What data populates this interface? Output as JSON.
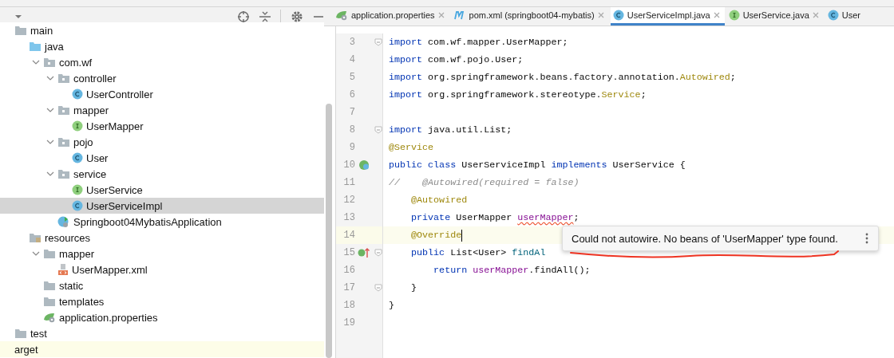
{
  "project_toolbar": {
    "buttons": [
      {
        "kind": "dropdown"
      },
      {
        "kind": "locate"
      },
      {
        "kind": "collapse"
      },
      {
        "kind": "settings"
      },
      {
        "kind": "minimize"
      }
    ]
  },
  "tabs": [
    {
      "label": "application.properties",
      "kind": "properties",
      "selected": false
    },
    {
      "label": "pom.xml (springboot04-mybatis)",
      "kind": "maven",
      "selected": false
    },
    {
      "label": "UserServiceImpl.java",
      "kind": "class",
      "selected": true
    },
    {
      "label": "UserService.java",
      "kind": "interface",
      "selected": false
    },
    {
      "label": "User",
      "kind": "class",
      "selected": false
    }
  ],
  "tree": [
    {
      "label": "main",
      "kind": "folder",
      "selected": false,
      "children": [
        {
          "label": "java",
          "kind": "source",
          "selected": false,
          "children": [
            {
              "label": "com.wf",
              "kind": "package",
              "expanded": true,
              "selected": false,
              "children": [
                {
                  "label": "controller",
                  "kind": "package",
                  "expanded": true,
                  "selected": false,
                  "children": [
                    {
                      "label": "UserController",
                      "kind": "class",
                      "selected": false
                    }
                  ]
                },
                {
                  "label": "mapper",
                  "kind": "package",
                  "expanded": true,
                  "selected": false,
                  "children": [
                    {
                      "label": "UserMapper",
                      "kind": "interface",
                      "selected": false
                    }
                  ]
                },
                {
                  "label": "pojo",
                  "kind": "package",
                  "expanded": true,
                  "selected": false,
                  "children": [
                    {
                      "label": "User",
                      "kind": "class",
                      "selected": false
                    }
                  ]
                },
                {
                  "label": "service",
                  "kind": "package",
                  "expanded": true,
                  "selected": false,
                  "children": [
                    {
                      "label": "UserService",
                      "kind": "interface",
                      "selected": false
                    },
                    {
                      "label": "UserServiceImpl",
                      "kind": "class",
                      "selected": true
                    }
                  ]
                },
                {
                  "label": "Springboot04MybatisApplication",
                  "kind": "app",
                  "selected": false
                }
              ]
            }
          ]
        },
        {
          "label": "resources",
          "kind": "resources",
          "selected": false,
          "children": [
            {
              "label": "mapper",
              "kind": "folder",
              "expanded": true,
              "selected": false,
              "children": [
                {
                  "label": "UserMapper.xml",
                  "kind": "xml",
                  "selected": false
                }
              ]
            },
            {
              "label": "static",
              "kind": "folder",
              "selected": false
            },
            {
              "label": "templates",
              "kind": "folder",
              "selected": false
            },
            {
              "label": "application.properties",
              "kind": "properties",
              "selected": false
            }
          ]
        }
      ]
    },
    {
      "label": "test",
      "kind": "folder",
      "selected": false
    },
    {
      "label": "arget",
      "kind": "excluded",
      "selected": false
    }
  ],
  "editor": {
    "lines": [
      {
        "number": "3",
        "kind": "plain",
        "fold": true,
        "tokens": [
          {
            "t": "import",
            "kind": "kw"
          },
          {
            "t": " com.wf.mapper.UserMapper;",
            "kind": "plain"
          }
        ]
      },
      {
        "number": "4",
        "kind": "plain",
        "tokens": [
          {
            "t": "import",
            "kind": "kw"
          },
          {
            "t": " com.wf.pojo.User;",
            "kind": "plain"
          }
        ]
      },
      {
        "number": "5",
        "kind": "plain",
        "tokens": [
          {
            "t": "import",
            "kind": "kw"
          },
          {
            "t": " org.springframework.beans.factory.annotation.",
            "kind": "plain"
          },
          {
            "t": "Autowired",
            "kind": "ann"
          },
          {
            "t": ";",
            "kind": "plain"
          }
        ]
      },
      {
        "number": "6",
        "kind": "plain",
        "tokens": [
          {
            "t": "import",
            "kind": "kw"
          },
          {
            "t": " org.springframework.stereotype.",
            "kind": "plain"
          },
          {
            "t": "Service",
            "kind": "ann"
          },
          {
            "t": ";",
            "kind": "plain"
          }
        ]
      },
      {
        "number": "7",
        "kind": "plain"
      },
      {
        "number": "8",
        "kind": "plain",
        "fold": true,
        "tokens": [
          {
            "t": "import",
            "kind": "kw"
          },
          {
            "t": " java.util.List;",
            "kind": "plain"
          }
        ]
      },
      {
        "number": "9",
        "kind": "plain",
        "tokens": [
          {
            "t": "@Service",
            "kind": "ann"
          }
        ]
      },
      {
        "number": "10",
        "kind": "bean",
        "tokens": [
          {
            "t": "public class",
            "kind": "kw"
          },
          {
            "t": " UserServiceImpl ",
            "kind": "plain"
          },
          {
            "t": "implements",
            "kind": "kw"
          },
          {
            "t": " UserService {",
            "kind": "plain"
          }
        ]
      },
      {
        "number": "11",
        "kind": "plain",
        "tokens": [
          {
            "t": "//    @Autowired(required = false)",
            "kind": "comment"
          }
        ]
      },
      {
        "number": "12",
        "kind": "plain",
        "tokens": [
          {
            "t": "    @Autowired",
            "kind": "ann"
          }
        ]
      },
      {
        "number": "13",
        "kind": "plain",
        "tokens": [
          {
            "t": "    private",
            "kind": "kw"
          },
          {
            "t": " UserMapper ",
            "kind": "plain"
          },
          {
            "t": "userMapper",
            "kind": "field",
            "error": true
          },
          {
            "t": ";",
            "kind": "plain"
          }
        ]
      },
      {
        "number": "14",
        "kind": "plain",
        "current": true,
        "tokens": [
          {
            "t": "    @Override",
            "kind": "ann"
          }
        ]
      },
      {
        "number": "15",
        "kind": "implements",
        "fold": true,
        "tokens": [
          {
            "t": "    public",
            "kind": "kw"
          },
          {
            "t": " List<User> ",
            "kind": "plain"
          },
          {
            "t": "findAl",
            "kind": "method"
          }
        ]
      },
      {
        "number": "16",
        "kind": "plain",
        "tokens": [
          {
            "t": "        return ",
            "kind": "kw"
          },
          {
            "t": "userMapper",
            "kind": "field"
          },
          {
            "t": ".findAll();",
            "kind": "plain"
          }
        ]
      },
      {
        "number": "17",
        "kind": "plain",
        "fold": true,
        "tokens": [
          {
            "t": "    }",
            "kind": "plain"
          }
        ]
      },
      {
        "number": "18",
        "kind": "plain",
        "tokens": [
          {
            "t": "}",
            "kind": "plain"
          }
        ]
      },
      {
        "number": "19",
        "kind": "plain"
      }
    ]
  },
  "tooltip": {
    "text": "Could not autowire. No beans of 'UserMapper' type found."
  }
}
